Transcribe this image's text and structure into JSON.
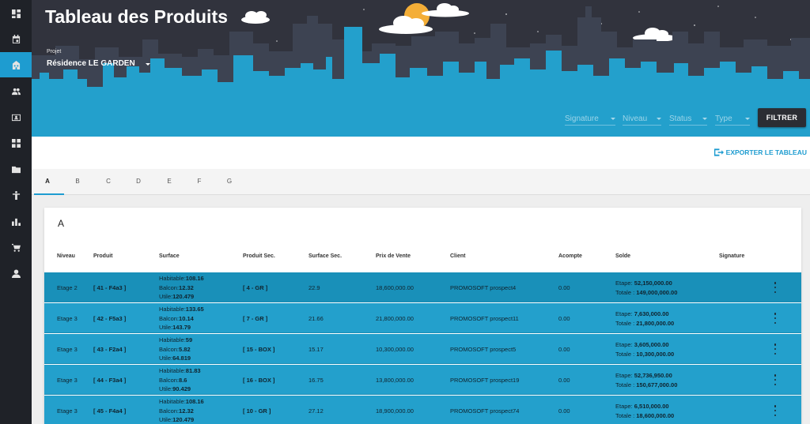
{
  "sidebar": {
    "icons": [
      "dashboard-icon",
      "calendar-icon",
      "building-icon",
      "users-icon",
      "contact-card-icon",
      "grid-icon",
      "folder-icon",
      "person-icon",
      "chart-icon",
      "cart-icon",
      "account-icon"
    ],
    "active_index": 2
  },
  "header": {
    "title": "Tableau des Produits",
    "projet_label": "Projet",
    "projet_value": "Résidence LE GARDEN",
    "filters": [
      "Signature",
      "Niveau",
      "Status",
      "Type"
    ],
    "filter_button": "FILTRER"
  },
  "export_label": "EXPORTER LE TABLEAU",
  "tabs": [
    "A",
    "B",
    "C",
    "D",
    "E",
    "F",
    "G"
  ],
  "active_tab": "A",
  "table": {
    "title": "A",
    "columns": [
      "Niveau",
      "Produit",
      "Surface",
      "Produit Sec.",
      "Surface Sec.",
      "Prix de Vente",
      "Client",
      "Acompte",
      "Solde",
      "Signature"
    ],
    "surface_labels": {
      "habitable": "Habitable:",
      "balcon": "Balcon:",
      "utile": "Utile:"
    },
    "solde_labels": {
      "etape": "Etape: ",
      "totale": "Totale : "
    },
    "rows": [
      {
        "niveau": "Etage 2",
        "produit": "[ 41 - F4a3 ]",
        "habitable": "108.16",
        "balcon": "12.32",
        "utile": "120.479",
        "produit_sec": "[ 4 - GR ]",
        "surface_sec": "22.9",
        "prix": "18,600,000.00",
        "client": "PROMOSOFT prospect4",
        "acompte": "0.00",
        "etape": "52,150,000.00",
        "totale": "149,000,000.00"
      },
      {
        "niveau": "Etage 3",
        "produit": "[ 42 - F5a3 ]",
        "habitable": "133.65",
        "balcon": "10.14",
        "utile": "143.79",
        "produit_sec": "[ 7 - GR ]",
        "surface_sec": "21.66",
        "prix": "21,800,000.00",
        "client": "PROMOSOFT prospect11",
        "acompte": "0.00",
        "etape": "7,630,000.00",
        "totale": "21,800,000.00"
      },
      {
        "niveau": "Etage 3",
        "produit": "[ 43 - F2a4 ]",
        "habitable": "59",
        "balcon": "5.82",
        "utile": "64.819",
        "produit_sec": "[ 15 - BOX ]",
        "surface_sec": "15.17",
        "prix": "10,300,000.00",
        "client": "PROMOSOFT prospect5",
        "acompte": "0.00",
        "etape": "3,605,000.00",
        "totale": "10,300,000.00"
      },
      {
        "niveau": "Etage 3",
        "produit": "[ 44 - F3a4 ]",
        "habitable": "81.83",
        "balcon": "8.6",
        "utile": "90.429",
        "produit_sec": "[ 16 - BOX ]",
        "surface_sec": "16.75",
        "prix": "13,800,000.00",
        "client": "PROMOSOFT prospect19",
        "acompte": "0.00",
        "etape": "52,736,950.00",
        "totale": "150,677,000.00"
      },
      {
        "niveau": "Etage 3",
        "produit": "[ 45 - F4a4 ]",
        "habitable": "108.16",
        "balcon": "12.32",
        "utile": "120.479",
        "produit_sec": "[ 10 - GR ]",
        "surface_sec": "27.12",
        "prix": "18,900,000.00",
        "client": "PROMOSOFT prospect74",
        "acompte": "0.00",
        "etape": "6,510,000.00",
        "totale": "18,600,000.00"
      }
    ]
  },
  "colors": {
    "accent": "#1e9cd0",
    "sidebar": "#1f2228",
    "header_sky": "#31333d",
    "row": "#23a0cc",
    "row_first": "#1990b9"
  }
}
